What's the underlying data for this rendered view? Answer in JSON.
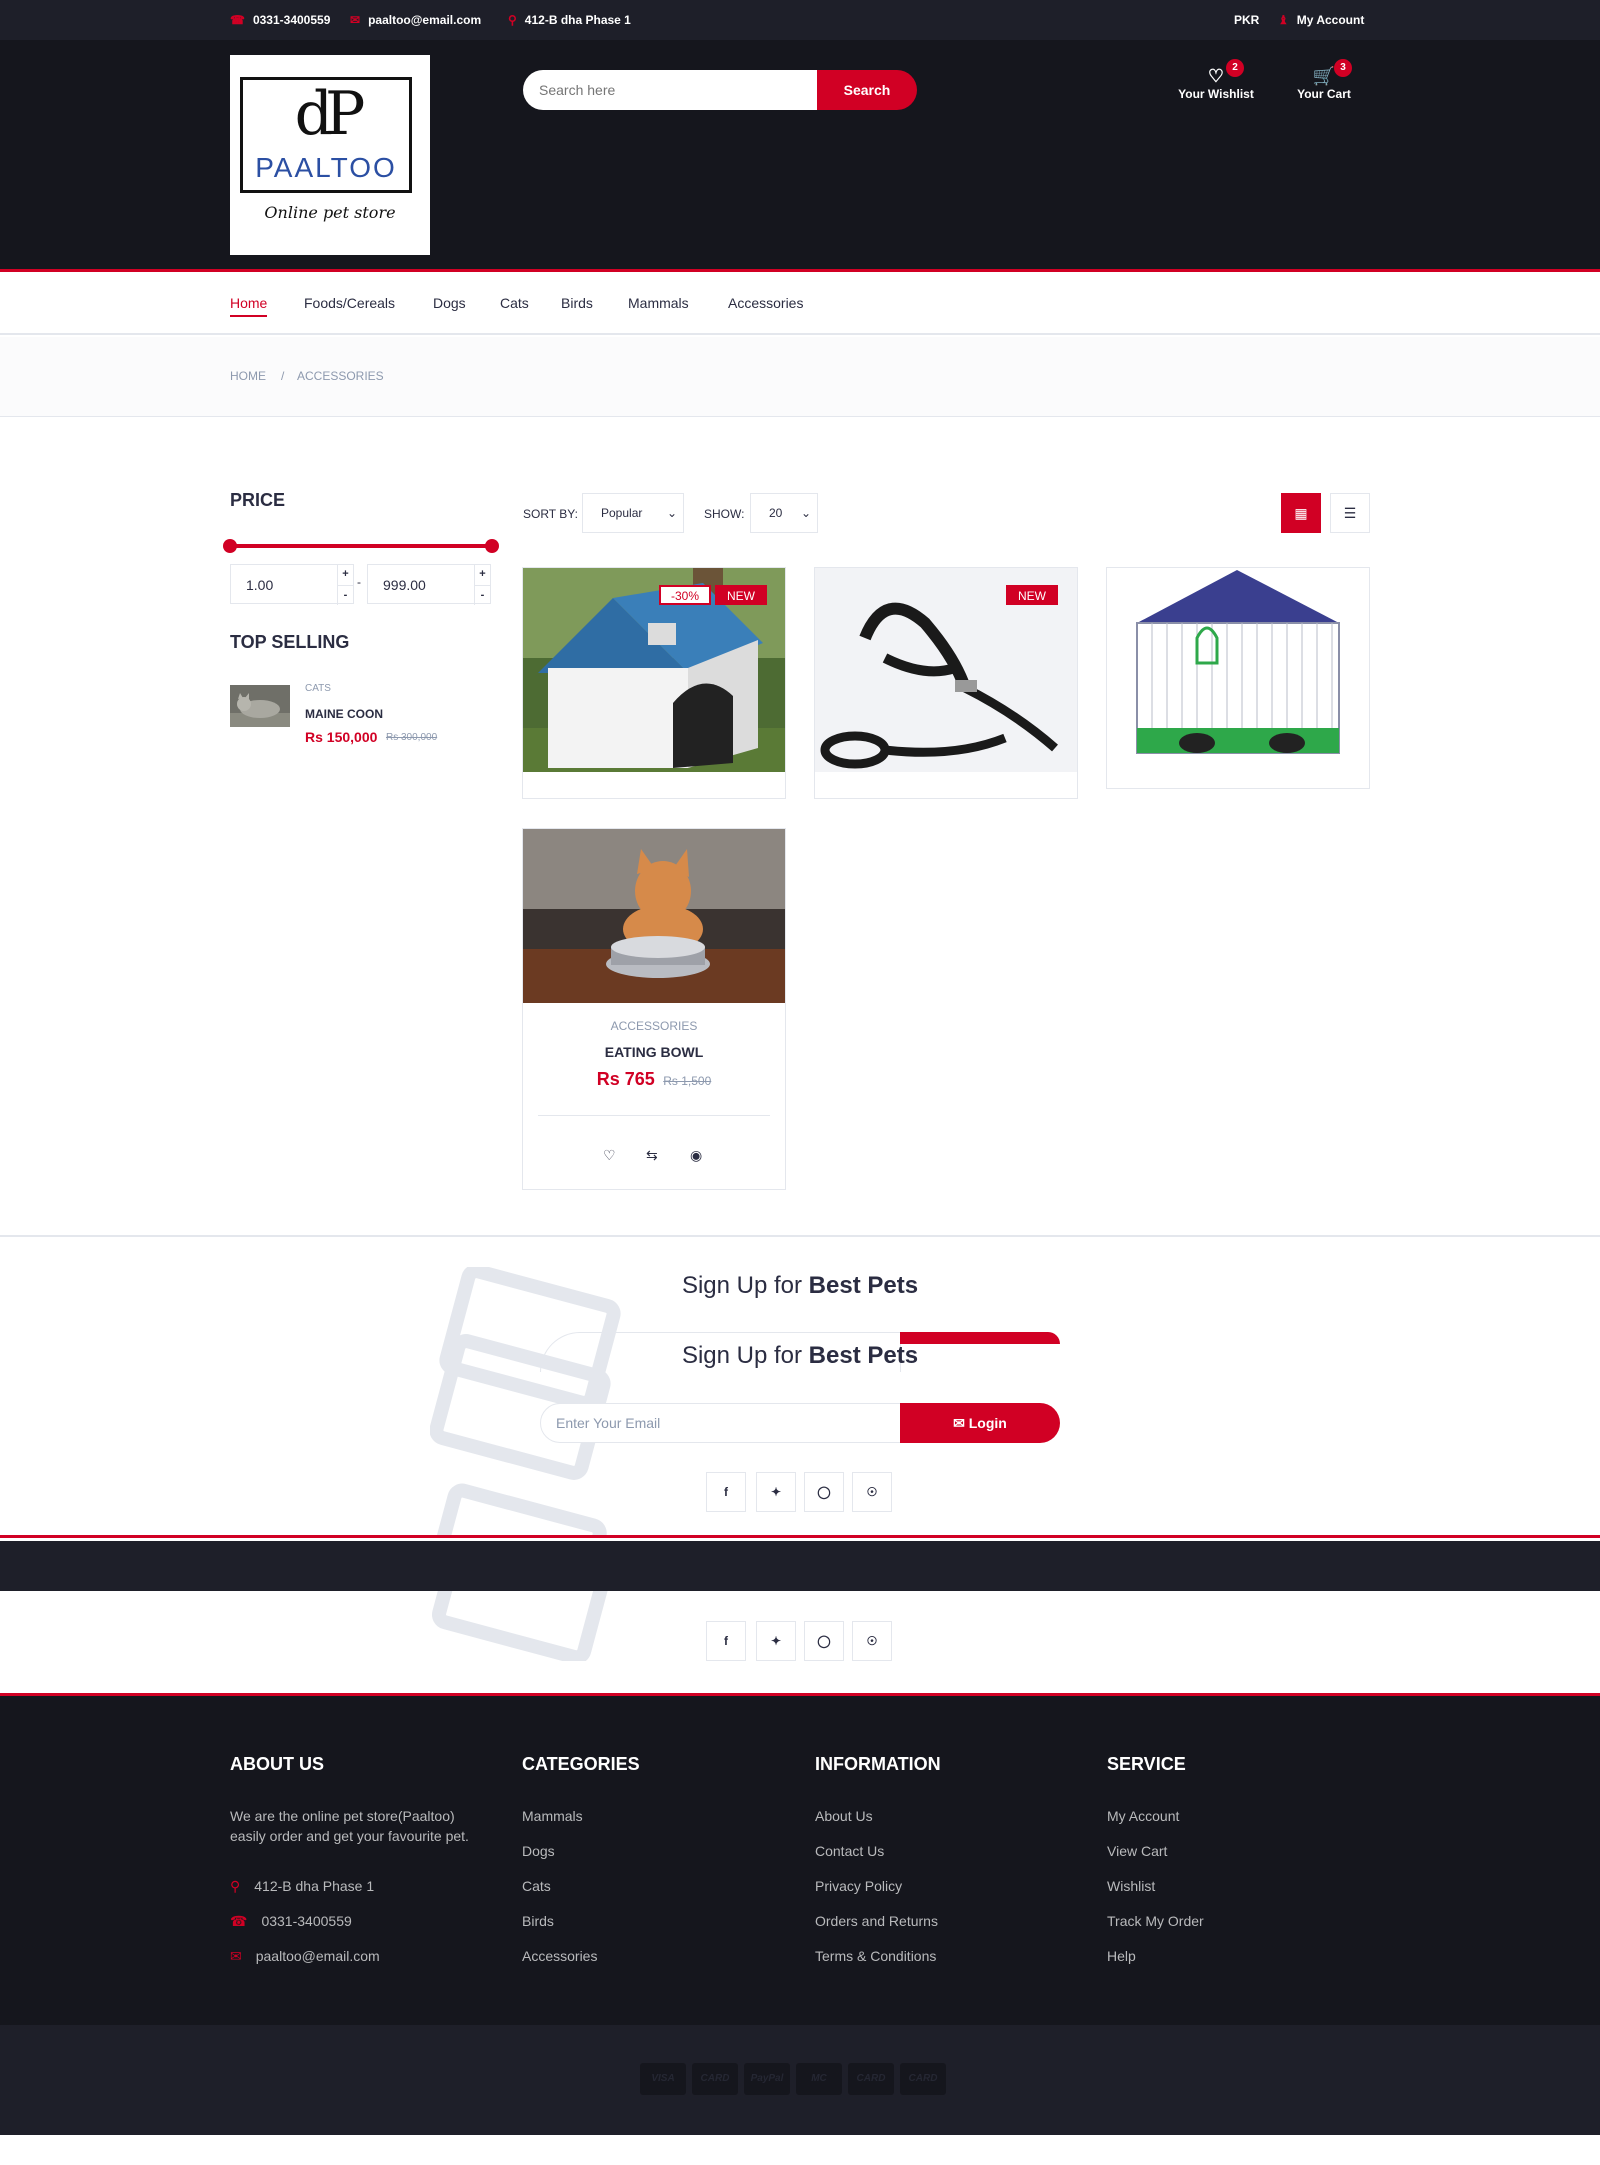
{
  "topbar": {
    "phone": "0331-3400559",
    "email": "paaltoo@email.com",
    "address": "412-B dha Phase 1",
    "currency": "PKR",
    "account": "My Account"
  },
  "logo": {
    "monogram": "dP",
    "brand": "PAALTOO",
    "tagline": "Online pet store"
  },
  "search": {
    "placeholder": "Search here",
    "button": "Search"
  },
  "header_widgets": {
    "wishlist": {
      "label": "Your Wishlist",
      "count": "2"
    },
    "cart": {
      "label": "Your Cart",
      "count": "3"
    }
  },
  "nav": {
    "items": [
      {
        "label": "Home",
        "active": true
      },
      {
        "label": "Foods/Cereals"
      },
      {
        "label": "Dogs"
      },
      {
        "label": "Cats"
      },
      {
        "label": "Birds"
      },
      {
        "label": "Mammals"
      },
      {
        "label": "Accessories"
      }
    ]
  },
  "breadcrumb": {
    "items": [
      "HOME",
      "/",
      "ACCESSORIES"
    ]
  },
  "aside": {
    "price_title": "PRICE",
    "price_min": "1.00",
    "price_max": "999.00",
    "price_min_fraction": 0,
    "price_max_fraction": 1,
    "top_selling_title": "TOP SELLING",
    "top_selling": [
      {
        "category": "CATS",
        "name": "MAINE COON",
        "price": "Rs 150,000",
        "old_price": "Rs 300,000"
      }
    ]
  },
  "store_filter": {
    "sort_label": "SORT BY:",
    "sort_value": "Popular",
    "show_label": "SHOW:",
    "show_value": "20"
  },
  "products": [
    {
      "image": "dog-house",
      "labels": [
        "-30%",
        "NEW"
      ]
    },
    {
      "image": "dog-harness",
      "labels": [
        "NEW"
      ]
    },
    {
      "image": "bird-cage",
      "labels": []
    },
    {
      "image": "cat-eating-bowl",
      "labels": [],
      "category": "ACCESSORIES",
      "name": "EATING BOWL",
      "price": "Rs 765",
      "old_price": "Rs 1,500"
    }
  ],
  "newsletter": {
    "title_prefix": "Sign Up for",
    "title_bold": "Best Pets",
    "placeholder": "Enter Your Email",
    "button": "Login",
    "social": [
      "f",
      "t",
      "ig",
      "p"
    ]
  },
  "footer": {
    "about": {
      "title": "ABOUT US",
      "text": "We are the online pet store(Paaltoo) easily order and get your favourite pet.",
      "address": "412-B dha Phase 1",
      "phone": "0331-3400559",
      "email": "paaltoo@email.com"
    },
    "categories": {
      "title": "CATEGORIES",
      "links": [
        "Mammals",
        "Dogs",
        "Cats",
        "Birds",
        "Accessories"
      ]
    },
    "information": {
      "title": "INFORMATION",
      "links": [
        "About Us",
        "Contact Us",
        "Privacy Policy",
        "Orders and Returns",
        "Terms & Conditions"
      ]
    },
    "service": {
      "title": "SERVICE",
      "links": [
        "My Account",
        "View Cart",
        "Wishlist",
        "Track My Order",
        "Help"
      ]
    }
  },
  "payment_icons": [
    "VISA",
    "CARD",
    "PayPal",
    "MC",
    "CARD",
    "CARD"
  ],
  "colors": {
    "accent": "#d10024",
    "dark": "#15161d",
    "topbar": "#1e1f29",
    "text": "#2b2d42",
    "muted": "#8d99ae"
  }
}
